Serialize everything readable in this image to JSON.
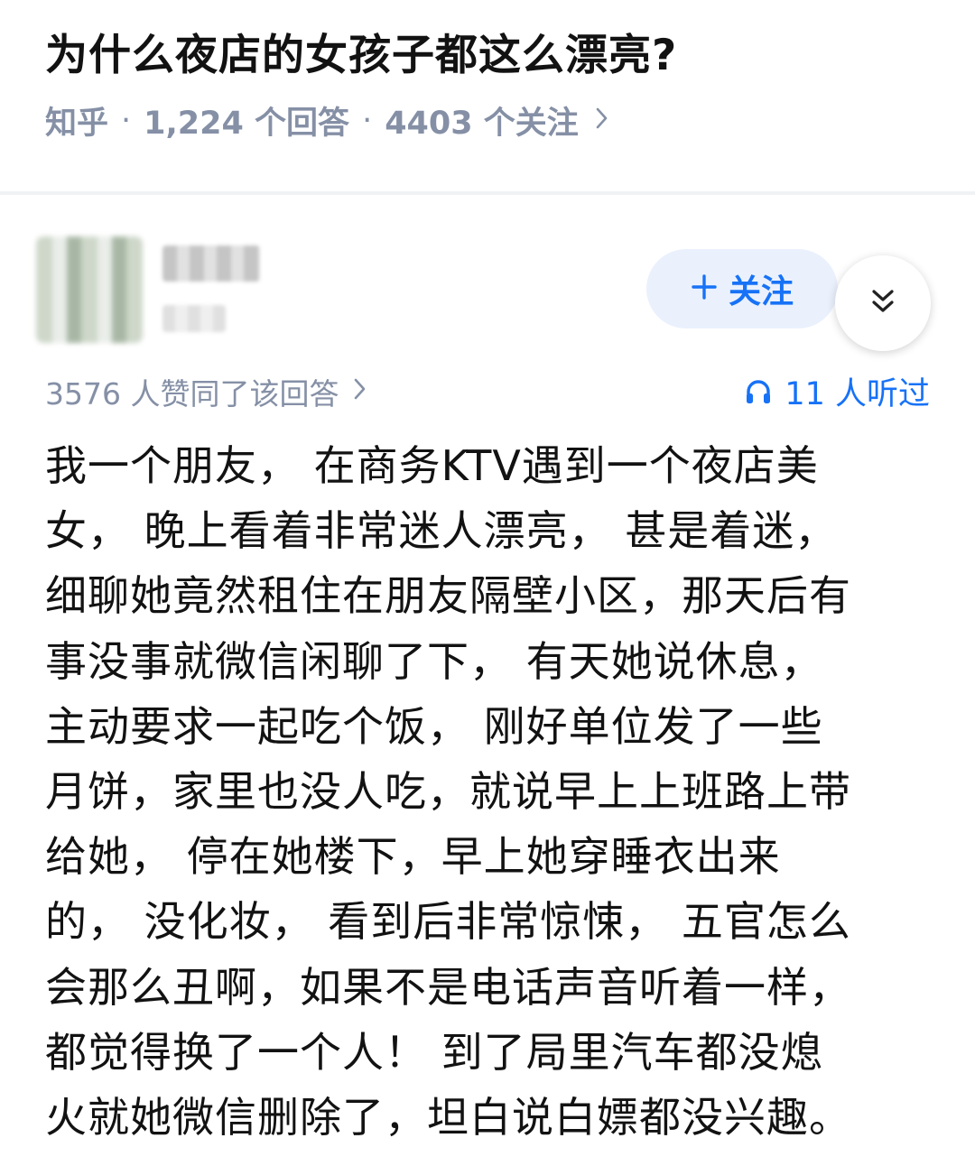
{
  "question": {
    "title": "为什么夜店的女孩子都这么漂亮?",
    "source": "知乎",
    "separator": "·",
    "answers": "1,224 个回答",
    "followers": "4403 个关注",
    "chevron_icon": "chevron-right-icon"
  },
  "author": {
    "follow_label": "关注",
    "follow_icon": "plus-icon",
    "collapse_icon": "double-chevron-down-icon"
  },
  "stats": {
    "votes": "3576 人赞同了该回答",
    "listen_icon": "headphones-icon",
    "listened": "11 人听过"
  },
  "answer": {
    "lines": [
      "我一个朋友， 在商务KTV遇到一个夜店美",
      "女， 晚上看着非常迷人漂亮， 甚是着迷，",
      "细聊她竟然租住在朋友隔壁小区，那天后有",
      "事没事就微信闲聊了下， 有天她说休息，",
      "主动要求一起吃个饭， 刚好单位发了一些",
      "月饼，家里也没人吃，就说早上上班路上带",
      "给她， 停在她楼下，早上她穿睡衣出来",
      "的， 没化妆， 看到后非常惊悚， 五官怎么",
      "会那么丑啊，如果不是电话声音听着一样，",
      "都觉得换了一个人！ 到了局里汽车都没熄",
      "火就她微信删除了，坦白说白嫖都没兴趣。"
    ]
  },
  "colors": {
    "accent": "#1772f6",
    "meta_gray": "#8590a6",
    "follow_bg": "#eaf1fd",
    "divider": "#f1f2f4"
  }
}
